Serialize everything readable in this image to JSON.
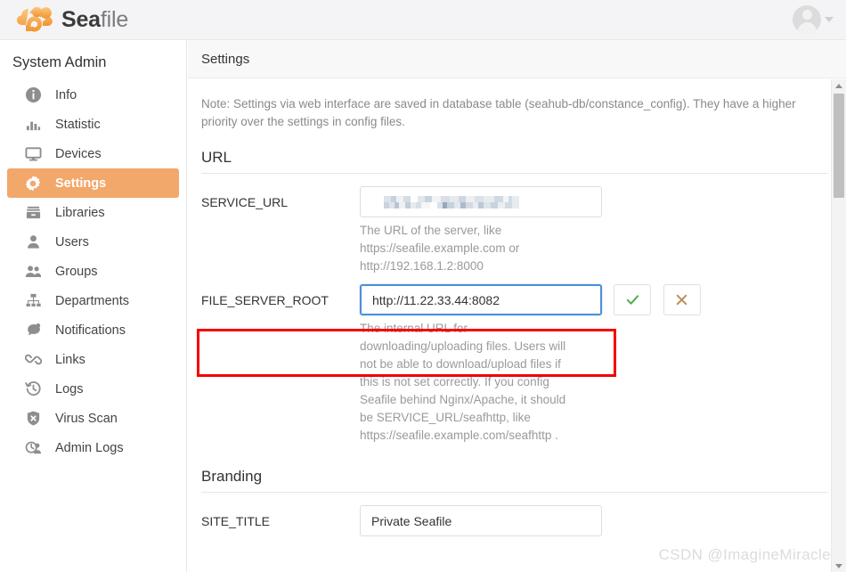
{
  "brand": {
    "name_bold": "Sea",
    "name_light": "file",
    "logo_icon": "cloud-icon"
  },
  "account": {
    "avatar_icon": "user-avatar-icon",
    "caret_icon": "chevron-down-icon"
  },
  "sidebar": {
    "title": "System Admin",
    "items": [
      {
        "label": "Info",
        "icon": "info-icon",
        "active": false
      },
      {
        "label": "Statistic",
        "icon": "bar-chart-icon",
        "active": false
      },
      {
        "label": "Devices",
        "icon": "monitor-icon",
        "active": false
      },
      {
        "label": "Settings",
        "icon": "gear-icon",
        "active": true
      },
      {
        "label": "Libraries",
        "icon": "library-icon",
        "active": false
      },
      {
        "label": "Users",
        "icon": "user-icon",
        "active": false
      },
      {
        "label": "Groups",
        "icon": "users-group-icon",
        "active": false
      },
      {
        "label": "Departments",
        "icon": "org-chart-icon",
        "active": false
      },
      {
        "label": "Notifications",
        "icon": "speech-bubble-icon",
        "active": false
      },
      {
        "label": "Links",
        "icon": "link-chain-icon",
        "active": false
      },
      {
        "label": "Logs",
        "icon": "history-clock-icon",
        "active": false
      },
      {
        "label": "Virus Scan",
        "icon": "shield-icon",
        "active": false
      },
      {
        "label": "Admin Logs",
        "icon": "admin-clock-user-icon",
        "active": false
      }
    ]
  },
  "content": {
    "header_title": "Settings",
    "note": "Note: Settings via web interface are saved in database table (seahub-db/constance_config). They have a higher priority over the settings in config files.",
    "sections": [
      {
        "title": "URL",
        "fields": [
          {
            "label": "SERVICE_URL",
            "value": "",
            "redacted": true,
            "help": "The URL of the server, like https://seafile.example.com or http://192.168.1.2:8000"
          },
          {
            "label": "FILE_SERVER_ROOT",
            "value": "http://11.22.33.44:8082",
            "redacted": false,
            "focused": true,
            "help": "The internal URL for downloading/uploading files. Users will not be able to download/upload files if this is not set correctly. If you config Seafile behind Nginx/Apache, it should be SERVICE_URL/seafhttp, like https://seafile.example.com/seafhttp .",
            "actions": [
              {
                "name": "confirm-button",
                "icon": "check-icon",
                "color": "#4caf50"
              },
              {
                "name": "cancel-button",
                "icon": "close-x-icon",
                "color": "#c58f5a"
              }
            ]
          }
        ]
      },
      {
        "title": "Branding",
        "fields": [
          {
            "label": "SITE_TITLE",
            "value": "Private Seafile",
            "redacted": false,
            "help": ""
          }
        ]
      }
    ]
  },
  "annotation": {
    "type": "red-rectangle-highlight",
    "color": "#f50000",
    "target": "FILE_SERVER_ROOT"
  },
  "watermark": "CSDN @ImagineMiracle",
  "scrollbar": {
    "up_icon": "scroll-up-arrow-icon",
    "down_icon": "scroll-down-arrow-icon"
  },
  "colors": {
    "accent": "#f2a76b",
    "brand_orange": "#f5a04a",
    "annotation_red": "#f50000",
    "focus_blue": "#4a90d9"
  }
}
